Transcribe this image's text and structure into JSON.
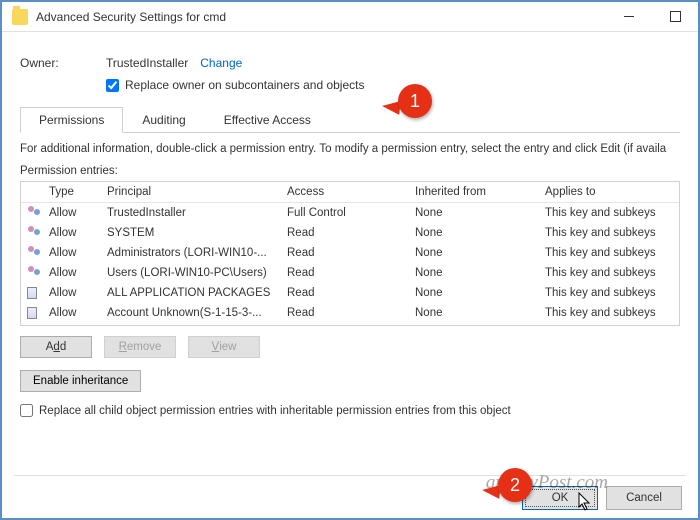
{
  "title": "Advanced Security Settings for cmd",
  "owner": {
    "label": "Owner:",
    "value": "TrustedInstaller",
    "change": "Change"
  },
  "replaceOwner": "Replace owner on subcontainers and objects",
  "tabs": {
    "permissions": "Permissions",
    "auditing": "Auditing",
    "effective": "Effective Access"
  },
  "infoText": "For additional information, double-click a permission entry. To modify a permission entry, select the entry and click Edit (if availa",
  "permLabel": "Permission entries:",
  "columns": {
    "type": "Type",
    "principal": "Principal",
    "access": "Access",
    "inherited": "Inherited from",
    "applies": "Applies to"
  },
  "rows": [
    {
      "icon": "grp",
      "type": "Allow",
      "principal": "TrustedInstaller",
      "access": "Full Control",
      "inherited": "None",
      "applies": "This key and subkeys"
    },
    {
      "icon": "grp",
      "type": "Allow",
      "principal": "SYSTEM",
      "access": "Read",
      "inherited": "None",
      "applies": "This key and subkeys"
    },
    {
      "icon": "grp",
      "type": "Allow",
      "principal": "Administrators (LORI-WIN10-...",
      "access": "Read",
      "inherited": "None",
      "applies": "This key and subkeys"
    },
    {
      "icon": "grp",
      "type": "Allow",
      "principal": "Users (LORI-WIN10-PC\\Users)",
      "access": "Read",
      "inherited": "None",
      "applies": "This key and subkeys"
    },
    {
      "icon": "key",
      "type": "Allow",
      "principal": "ALL APPLICATION PACKAGES",
      "access": "Read",
      "inherited": "None",
      "applies": "This key and subkeys"
    },
    {
      "icon": "key",
      "type": "Allow",
      "principal": "Account Unknown(S-1-15-3-...",
      "access": "Read",
      "inherited": "None",
      "applies": "This key and subkeys"
    }
  ],
  "buttons": {
    "add": "Add",
    "remove": "Remove",
    "view": "View",
    "enable": "Enable inheritance",
    "ok": "OK",
    "cancel": "Cancel"
  },
  "replaceAll": "Replace all child object permission entries with inheritable permission entries from this object",
  "watermark": "groovyPost.com",
  "callouts": {
    "one": "1",
    "two": "2"
  }
}
